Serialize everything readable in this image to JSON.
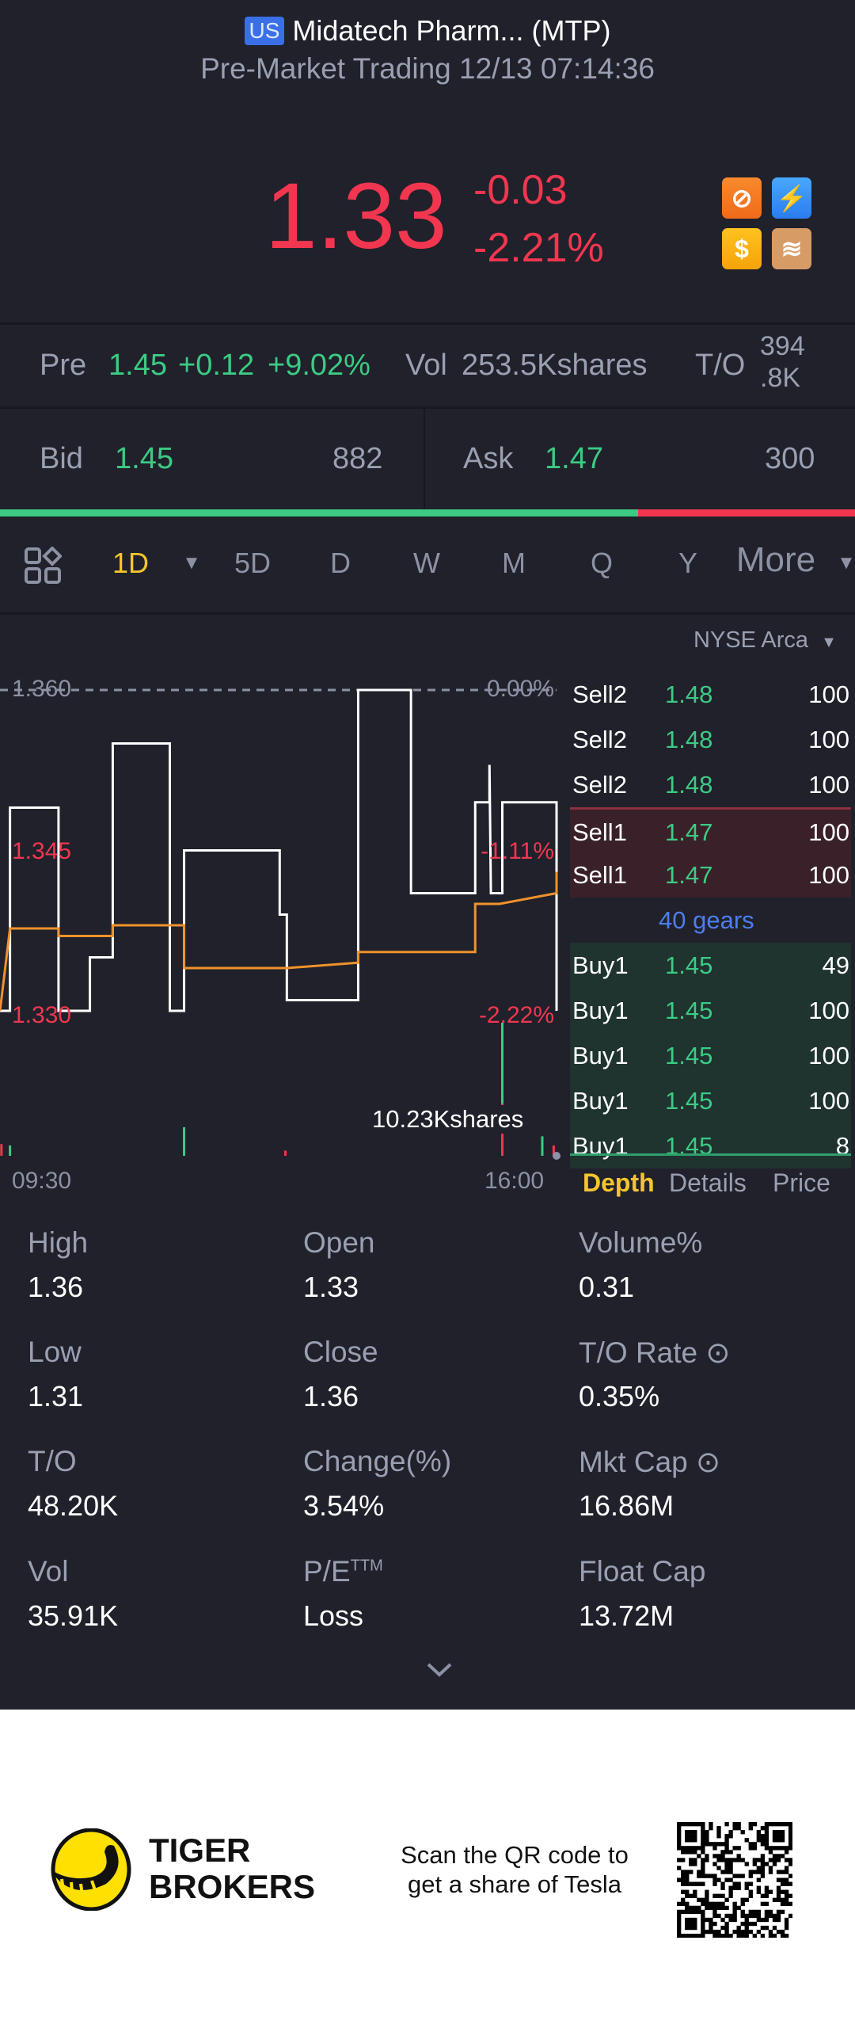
{
  "header": {
    "market_badge": "US",
    "title": "Midatech Pharm... (MTP)",
    "subtitle": "Pre-Market Trading 12/13 07:14:36"
  },
  "quote": {
    "price": "1.33",
    "change": "-0.03",
    "change_pct": "-2.21%",
    "icons": [
      "no-short-icon",
      "lightning-level1-icon",
      "dollar-icon",
      "layers-a-icon"
    ]
  },
  "pre": {
    "label": "Pre",
    "price": "1.45",
    "change": "+0.12",
    "change_pct": "+9.02%",
    "vol_label": "Vol",
    "vol": "253.5Kshares",
    "to_label": "T/O",
    "to_line1": "394",
    "to_line2": ".8K"
  },
  "bidask": {
    "bid_label": "Bid",
    "bid": "1.45",
    "bid_size": "882",
    "ask_label": "Ask",
    "ask": "1.47",
    "ask_size": "300",
    "bid_ratio": 0.746
  },
  "periods": {
    "items": [
      "1D",
      "5D",
      "D",
      "W",
      "M",
      "Q",
      "Y"
    ],
    "more": "More",
    "active": "1D"
  },
  "exchange": "NYSE Arca",
  "chart_data": {
    "type": "line",
    "x_unit": "minutes since 09:30",
    "xlim": [
      0,
      390
    ],
    "ylim": [
      1.33,
      1.36
    ],
    "x_ticks": [
      "09:30",
      "16:00"
    ],
    "y_labels": {
      "top": "1.360",
      "mid": "1.345",
      "bottom": "1.330"
    },
    "pct_labels": {
      "top": "0.00%",
      "mid": "-1.11%",
      "bottom": "-2.22%"
    },
    "series": [
      {
        "name": "price",
        "color": "#ffffff",
        "points": [
          [
            0,
            1.33
          ],
          [
            7,
            1.33
          ],
          [
            7,
            1.349
          ],
          [
            41,
            1.349
          ],
          [
            41,
            1.33
          ],
          [
            63,
            1.33
          ],
          [
            63,
            1.335
          ],
          [
            79,
            1.335
          ],
          [
            79,
            1.355
          ],
          [
            119,
            1.355
          ],
          [
            119,
            1.33
          ],
          [
            129,
            1.33
          ],
          [
            129,
            1.345
          ],
          [
            196,
            1.345
          ],
          [
            196,
            1.339
          ],
          [
            201,
            1.339
          ],
          [
            201,
            1.331
          ],
          [
            251,
            1.331
          ],
          [
            251,
            1.36
          ],
          [
            288,
            1.36
          ],
          [
            288,
            1.341
          ],
          [
            333,
            1.341
          ],
          [
            333,
            1.3495
          ],
          [
            343,
            1.3495
          ],
          [
            343,
            1.353
          ],
          [
            344,
            1.341
          ],
          [
            352,
            1.341
          ],
          [
            352,
            1.3495
          ],
          [
            390,
            1.3495
          ],
          [
            390,
            1.33
          ]
        ]
      },
      {
        "name": "average",
        "color": "#f0922b",
        "points": [
          [
            0,
            1.33
          ],
          [
            7,
            1.3377
          ],
          [
            41,
            1.3377
          ],
          [
            41,
            1.337
          ],
          [
            79,
            1.337
          ],
          [
            79,
            1.338
          ],
          [
            129,
            1.338
          ],
          [
            129,
            1.334
          ],
          [
            201,
            1.334
          ],
          [
            251,
            1.3345
          ],
          [
            251,
            1.3355
          ],
          [
            333,
            1.3355
          ],
          [
            333,
            1.34
          ],
          [
            350,
            1.34
          ],
          [
            390,
            1.341
          ],
          [
            390,
            1.343
          ]
        ]
      }
    ],
    "volume": {
      "max_label": "10.23Kshares",
      "max": 10230,
      "bars": [
        [
          1,
          900,
          "down"
        ],
        [
          7,
          800,
          "up"
        ],
        [
          129,
          2200,
          "up"
        ],
        [
          200,
          400,
          "down"
        ],
        [
          352,
          10230,
          "up"
        ],
        [
          352,
          4000,
          "down"
        ],
        [
          380,
          1500,
          "up"
        ],
        [
          388,
          800,
          "down"
        ]
      ]
    }
  },
  "depth": {
    "rows": [
      {
        "side": "Sell2",
        "price": "1.48",
        "size": "100",
        "type": "sell-far"
      },
      {
        "side": "Sell2",
        "price": "1.48",
        "size": "100",
        "type": "sell-far"
      },
      {
        "side": "Sell2",
        "price": "1.48",
        "size": "100",
        "type": "sell-far"
      },
      {
        "side": "Sell1",
        "price": "1.47",
        "size": "100",
        "type": "sell"
      },
      {
        "side": "Sell1",
        "price": "1.47",
        "size": "100",
        "type": "sell"
      },
      {
        "gears": "40 gears",
        "type": "gears"
      },
      {
        "side": "Buy1",
        "price": "1.45",
        "size": "49",
        "type": "buy"
      },
      {
        "side": "Buy1",
        "price": "1.45",
        "size": "100",
        "type": "buy"
      },
      {
        "side": "Buy1",
        "price": "1.45",
        "size": "100",
        "type": "buy"
      },
      {
        "side": "Buy1",
        "price": "1.45",
        "size": "100",
        "type": "buy"
      },
      {
        "side": "Buy1",
        "price": "1.45",
        "size": "8",
        "type": "buy"
      }
    ],
    "tabs": [
      "Depth",
      "Details",
      "Price"
    ]
  },
  "stats": [
    {
      "label": "High",
      "value": "1.36"
    },
    {
      "label": "Open",
      "value": "1.33"
    },
    {
      "label": "Volume%",
      "value": "0.31"
    },
    {
      "label": "Low",
      "value": "1.31"
    },
    {
      "label": "Close",
      "value": "1.36"
    },
    {
      "label": "T/O Rate",
      "value": "0.35%",
      "info": true
    },
    {
      "label": "T/O",
      "value": "48.20K"
    },
    {
      "label": "Change(%)",
      "value": "3.54%"
    },
    {
      "label": "Mkt Cap",
      "value": "16.86M",
      "info": true
    },
    {
      "label": "Vol",
      "value": "35.91K"
    },
    {
      "label": "P/E",
      "sup": "TTM",
      "value": "Loss"
    },
    {
      "label": "Float Cap",
      "value": "13.72M"
    }
  ],
  "banner": {
    "brand_line1": "TIGER",
    "brand_line2": "BROKERS",
    "cta_line1": "Scan the QR code to",
    "cta_line2": "get a share of Tesla"
  },
  "colors": {
    "bg": "#20212b",
    "up": "#3ccb84",
    "down": "#f2364f",
    "accent": "#f5c62c",
    "link": "#4d7ef0"
  }
}
